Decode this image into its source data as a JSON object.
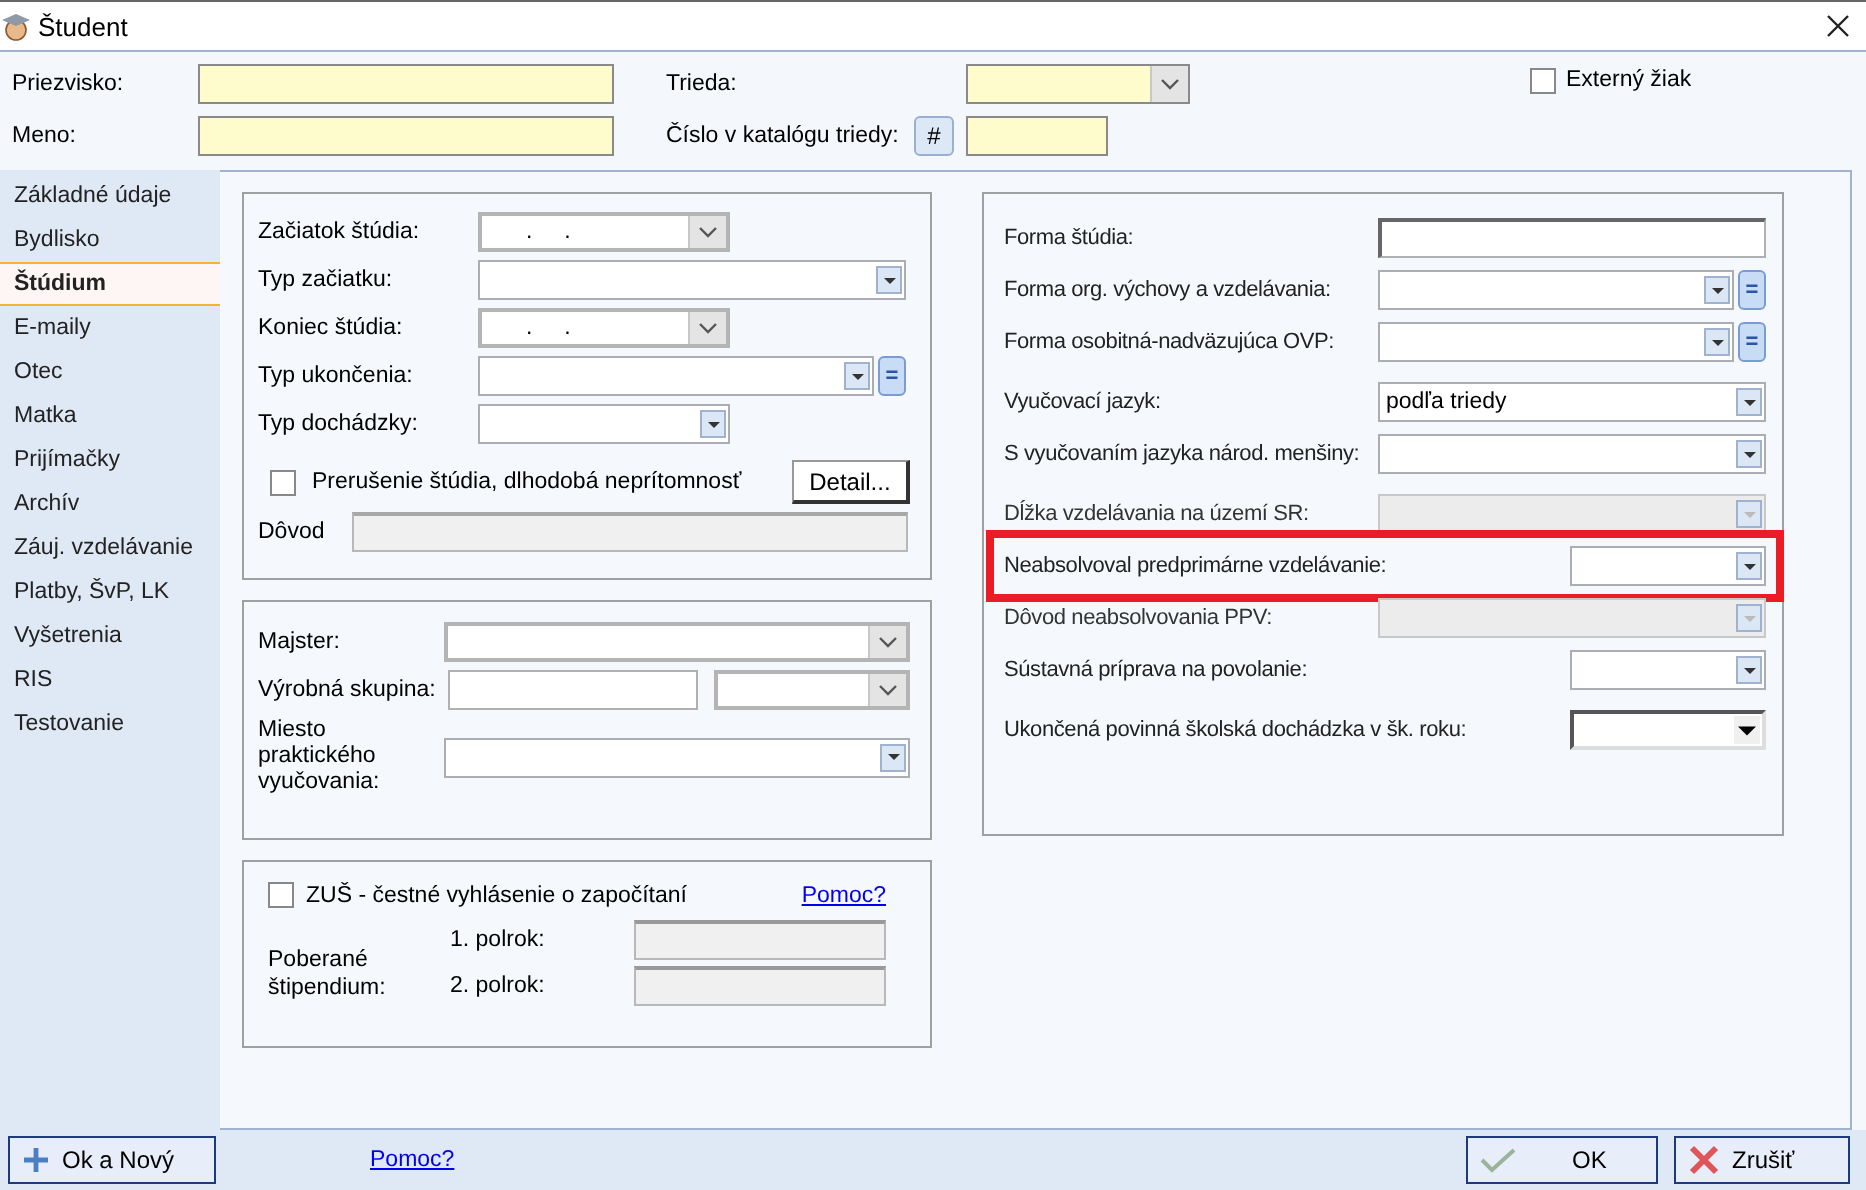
{
  "window": {
    "title": "Študent"
  },
  "header": {
    "fields": [
      {
        "label": "Priezvisko:",
        "kind": "text"
      },
      {
        "label": "Meno:",
        "kind": "text"
      }
    ],
    "class_field": {
      "label": "Trieda:"
    },
    "catalog": {
      "label": "Číslo v katalógu triedy:",
      "button": "#"
    },
    "external": {
      "label": "Externý žiak",
      "checked": false
    }
  },
  "nav": [
    {
      "label": "Základné údaje",
      "selected": false
    },
    {
      "label": "Bydlisko",
      "selected": false
    },
    {
      "label": "Štúdium",
      "selected": true
    },
    {
      "label": "E-maily",
      "selected": false
    },
    {
      "label": "Otec",
      "selected": false
    },
    {
      "label": "Matka",
      "selected": false
    },
    {
      "label": "Prijímačky",
      "selected": false
    },
    {
      "label": "Archív",
      "selected": false
    },
    {
      "label": "Záuj. vzdelávanie",
      "selected": false
    },
    {
      "label": "Platby, ŠvP, LK",
      "selected": false
    },
    {
      "label": "Vyšetrenia",
      "selected": false
    },
    {
      "label": "RIS",
      "selected": false
    },
    {
      "label": "Testovanie",
      "selected": false
    }
  ],
  "study": {
    "fields": [
      {
        "label": "Začiatok štúdia:",
        "kind": "date",
        "value": ".     ."
      },
      {
        "label": "Typ začiatku:",
        "kind": "combo"
      },
      {
        "label": "Koniec štúdia:",
        "kind": "date",
        "value": ".     ."
      },
      {
        "label": "Typ ukončenia:",
        "kind": "combo",
        "side_button": "="
      },
      {
        "label": "Typ dochádzky:",
        "kind": "combo"
      }
    ],
    "interruption": {
      "label": "Prerušenie štúdia, dlhodobá neprítomnosť",
      "checked": false,
      "button": "Detail..."
    },
    "reason": {
      "label": "Dôvod"
    }
  },
  "practice": {
    "fields": [
      {
        "label": "Majster:",
        "kind": "list"
      },
      {
        "label": "Výrobná skupina:",
        "kind": "text_list"
      },
      {
        "label": "Miesto praktického vyučovania:",
        "kind": "combo"
      }
    ]
  },
  "art_school": {
    "checkbox": {
      "label": "ZUŠ - čestné vyhlásenie o započítaní",
      "checked": false
    },
    "help_link": "Pomoc?",
    "stipend_label": "Poberané štipendium:",
    "terms": [
      "1. polrok:",
      "2. polrok:"
    ]
  },
  "form": {
    "fields": [
      {
        "label": "Forma štúdia:",
        "kind": "text",
        "disabled": false,
        "short": false,
        "highlighted": false
      },
      {
        "label": "Forma org. výchovy a vzdelávania:",
        "kind": "combo",
        "side_button": "=",
        "disabled": false,
        "short": false,
        "highlighted": false
      },
      {
        "label": "Forma osobitná-nadväzujúca OVP:",
        "kind": "combo",
        "side_button": "=",
        "disabled": false,
        "short": false,
        "highlighted": false
      },
      {
        "label": "Vyučovací jazyk:",
        "kind": "combo",
        "value": "podľa triedy",
        "disabled": false,
        "short": false,
        "highlighted": false
      },
      {
        "label": "S vyučovaním jazyka národ. menšiny:",
        "kind": "combo",
        "disabled": false,
        "short": false,
        "highlighted": false
      },
      {
        "label": "Dĺžka vzdelávania na území SR:",
        "kind": "combo",
        "disabled": true,
        "short": false,
        "highlighted": false
      },
      {
        "label": "Neabsolvoval predprimárne vzdelávanie:",
        "kind": "combo",
        "disabled": false,
        "short": true,
        "highlighted": true
      },
      {
        "label": "Dôvod neabsolvovania PPV:",
        "kind": "combo",
        "disabled": true,
        "short": false,
        "highlighted": false
      },
      {
        "label": "Sústavná príprava na povolanie:",
        "kind": "combo",
        "disabled": false,
        "short": true,
        "highlighted": false
      },
      {
        "label": "Ukončená povinná školská dochádzka v šk. roku:",
        "kind": "dropdown",
        "disabled": false,
        "short": true,
        "highlighted": false
      }
    ]
  },
  "footer": {
    "left_button": {
      "label": "Ok a Nový",
      "kind": "add"
    },
    "help_link": "Pomoc?",
    "buttons": [
      {
        "label": "OK",
        "kind": "ok"
      },
      {
        "label": "Zrušiť",
        "kind": "cancel"
      }
    ]
  }
}
